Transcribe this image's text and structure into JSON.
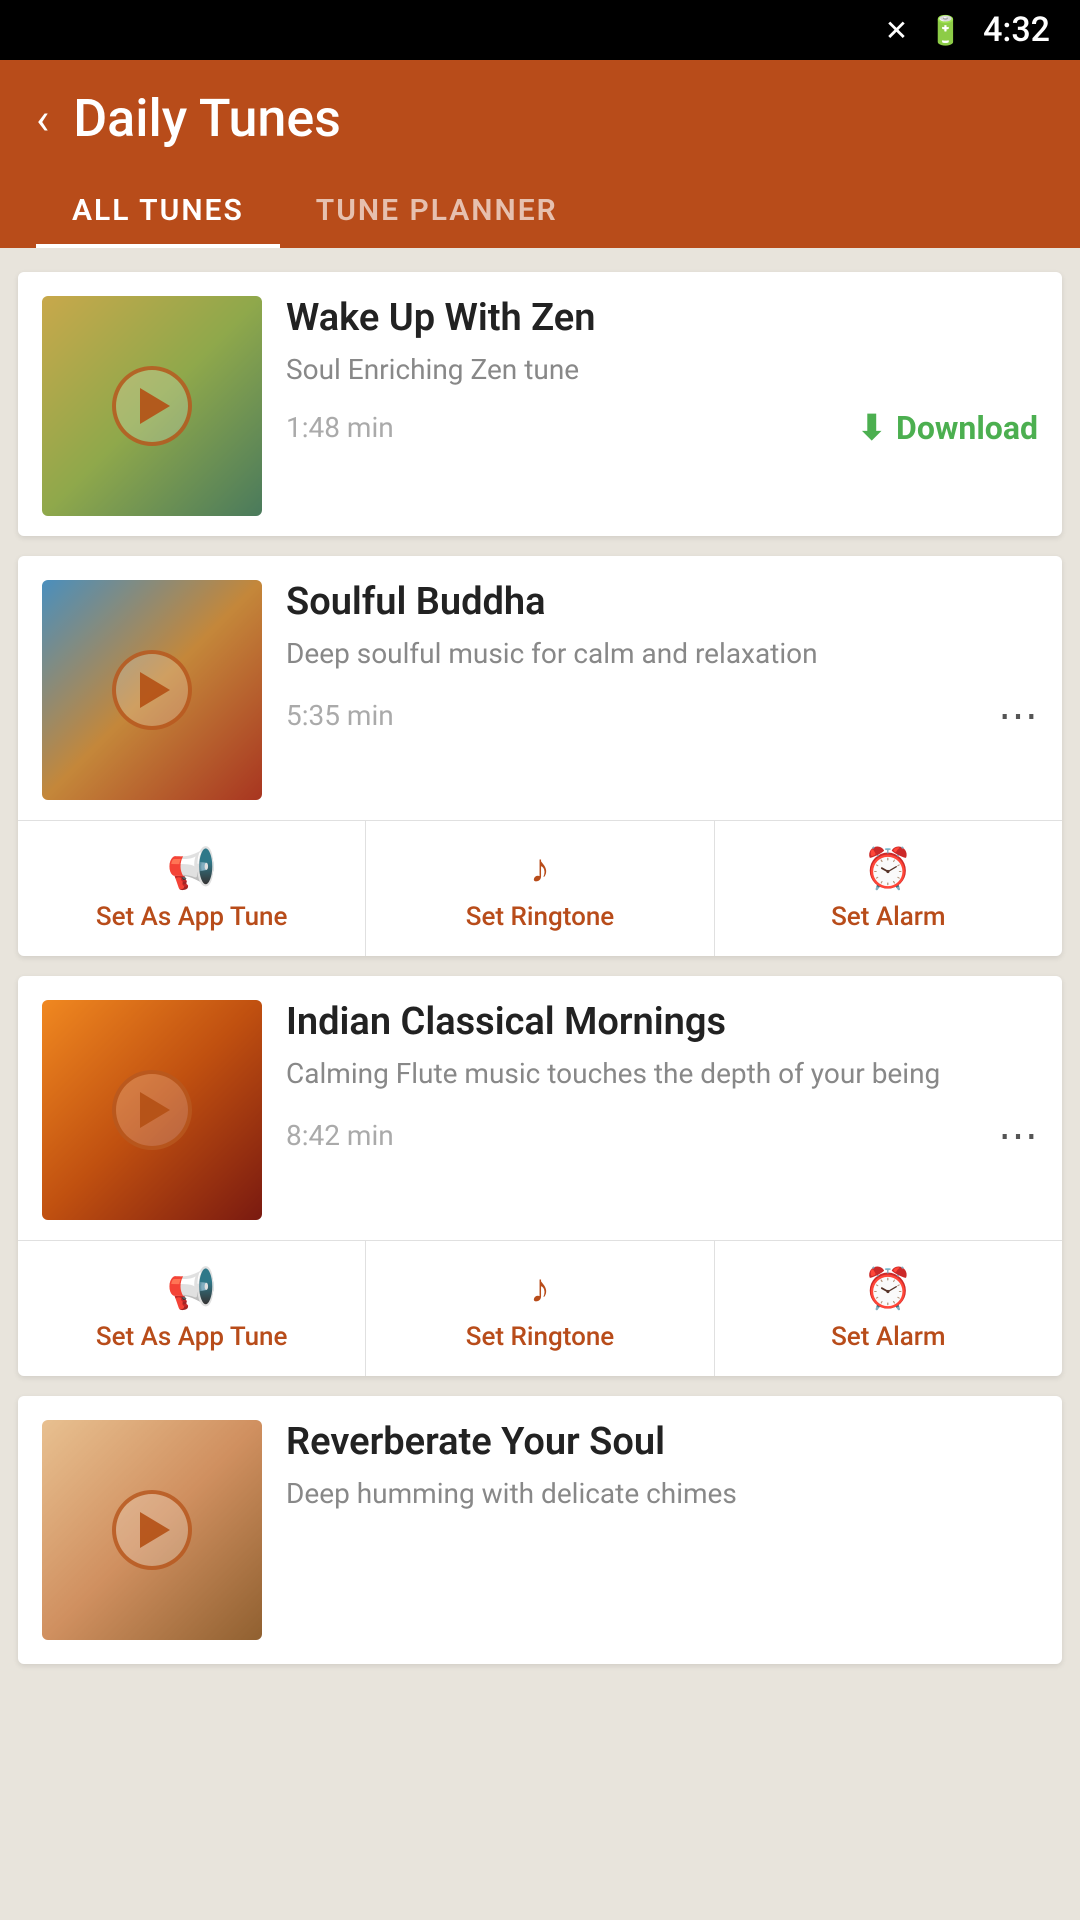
{
  "statusBar": {
    "time": "4:32",
    "icons": [
      "signal",
      "battery"
    ]
  },
  "header": {
    "backLabel": "‹",
    "title": "Daily Tunes",
    "tabs": [
      {
        "id": "all-tunes",
        "label": "ALL TUNES",
        "active": true
      },
      {
        "id": "tune-planner",
        "label": "TUNE PLANNER",
        "active": false
      }
    ]
  },
  "tunes": [
    {
      "id": "wake-up-zen",
      "title": "Wake Up With Zen",
      "subtitle": "Soul Enriching Zen tune",
      "duration": "1:48 min",
      "thumbClass": "thumb-zen",
      "action": "download",
      "downloadLabel": "Download",
      "hasActionBar": false
    },
    {
      "id": "soulful-buddha",
      "title": "Soulful Buddha",
      "subtitle": "Deep soulful music for calm and relaxation",
      "duration": "5:35 min",
      "thumbClass": "thumb-buddha",
      "action": "share",
      "hasActionBar": true,
      "actions": [
        {
          "icon": "📢",
          "label": "Set As App Tune"
        },
        {
          "icon": "🎵",
          "label": "Set Ringtone"
        },
        {
          "icon": "⏰",
          "label": "Set Alarm"
        }
      ]
    },
    {
      "id": "indian-classical-mornings",
      "title": "Indian Classical Mornings",
      "subtitle": "Calming Flute music touches the depth of your being",
      "duration": "8:42 min",
      "thumbClass": "thumb-indian",
      "action": "share",
      "hasActionBar": true,
      "actions": [
        {
          "icon": "📢",
          "label": "Set As App Tune"
        },
        {
          "icon": "🎵",
          "label": "Set Ringtone"
        },
        {
          "icon": "⏰",
          "label": "Set Alarm"
        }
      ]
    },
    {
      "id": "reverberate-your-soul",
      "title": "Reverberate Your Soul",
      "subtitle": "Deep humming with delicate chimes",
      "duration": "",
      "thumbClass": "thumb-reverberate",
      "action": "none",
      "hasActionBar": false,
      "partial": true
    }
  ],
  "actions": {
    "setAppTune": "Set As App Tune",
    "setRingtone": "Set Ringtone",
    "setAlarm": "Set Alarm",
    "download": "Download"
  }
}
